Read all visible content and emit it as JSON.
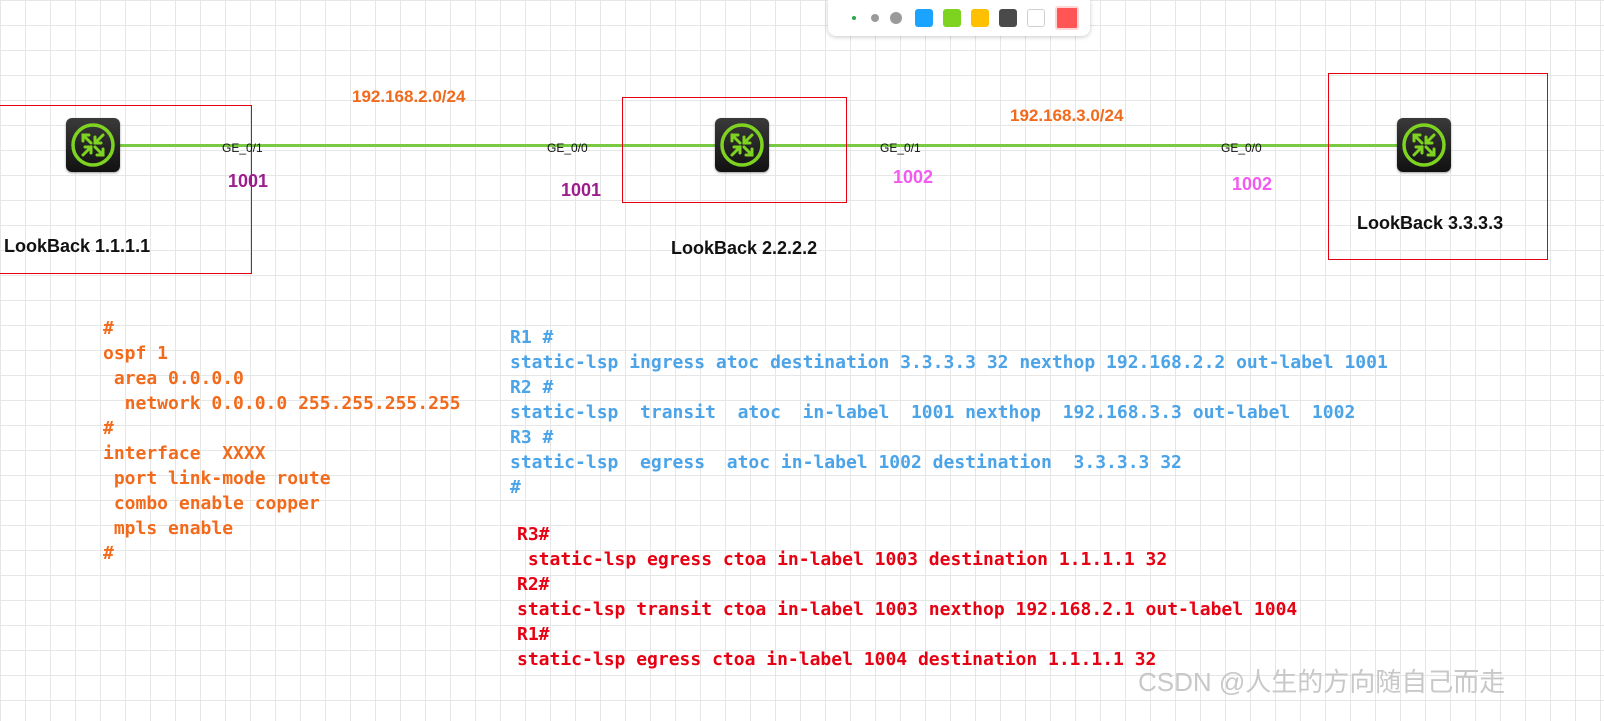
{
  "palette": {
    "swatches": [
      "#1aa3ff",
      "#7ed321",
      "#ffc000",
      "#4a4a4a",
      "#ffffff",
      "#ff5555"
    ]
  },
  "links": {
    "left_network": "192.168.2.0/24",
    "right_network": "192.168.3.0/24",
    "link_color": "#7ac943"
  },
  "interfaces": {
    "r1_ge01": "GE_0/1",
    "r2_ge00": "GE_0/0",
    "r2_ge01": "GE_0/1",
    "r3_ge00": "GE_0/0"
  },
  "labels": {
    "r1_out": "1001",
    "r2_in": "1001",
    "r2_out": "1002",
    "r3_in": "1002"
  },
  "routers": {
    "r1": {
      "icon": "router-icon",
      "loopback": "LookBack 1.1.1.1"
    },
    "r2": {
      "icon": "router-icon",
      "loopback": "LookBack 2.2.2.2"
    },
    "r3": {
      "icon": "router-icon",
      "loopback": "LookBack 3.3.3.3"
    }
  },
  "ospf_config": [
    "#",
    "ospf 1",
    " area 0.0.0.0",
    "  network 0.0.0.0 255.255.255.255",
    "#",
    "interface  XXXX",
    " port link-mode route",
    " combo enable copper",
    " mpls enable",
    "#"
  ],
  "atoc_config": [
    "R1 #",
    "static-lsp ingress atoc destination 3.3.3.3 32 nexthop 192.168.2.2 out-label 1001",
    "R2 #",
    "static-lsp  transit  atoc  in-label  1001 nexthop  192.168.3.3 out-label  1002",
    "R3 #",
    "static-lsp  egress  atoc in-label 1002 destination  3.3.3.3 32",
    "#"
  ],
  "ctoa_config": [
    "R3#",
    " static-lsp egress ctoa in-label 1003 destination 1.1.1.1 32",
    "R2#",
    "static-lsp transit ctoa in-label 1003 nexthop 192.168.2.1 out-label 1004",
    "R1#",
    "static-lsp egress ctoa in-label 1004 destination 1.1.1.1 32"
  ],
  "watermark": "CSDN @人生的方向随自己而走"
}
